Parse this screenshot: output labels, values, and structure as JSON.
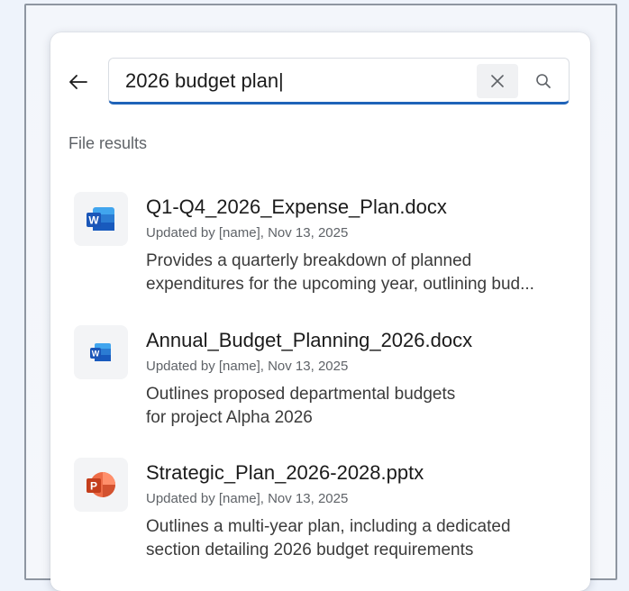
{
  "search": {
    "value": "2026 budget plan|",
    "accent_color": "#1f63b8"
  },
  "icons": {
    "back": "arrow-left-icon",
    "clear": "close-icon",
    "search": "search-icon"
  },
  "section": {
    "title": "File results"
  },
  "results": [
    {
      "name": "Q1-Q4_2026_Expense_Plan.docx",
      "meta": "Updated by [name], Nov 13, 2025",
      "desc_line1": "Provides a quarterly breakdown of planned",
      "desc_line2": "expenditures for the upcoming year, outlining bud...",
      "icon": "word-icon",
      "icon_letter": "W"
    },
    {
      "name": "Annual_Budget_Planning_2026.docx",
      "meta": "Updated by [name], Nov 13, 2025",
      "desc_line1": "Outlines proposed departmental budgets",
      "desc_line2": "for project Alpha 2026",
      "icon": "word-icon",
      "icon_letter": "W"
    },
    {
      "name": "Strategic_Plan_2026-2028.pptx",
      "meta": "Updated by [name], Nov 13, 2025",
      "desc_line1": "Outlines a multi-year plan, including a dedicated",
      "desc_line2": "section detailing 2026 budget requirements",
      "icon": "powerpoint-icon",
      "icon_letter": "P"
    }
  ]
}
